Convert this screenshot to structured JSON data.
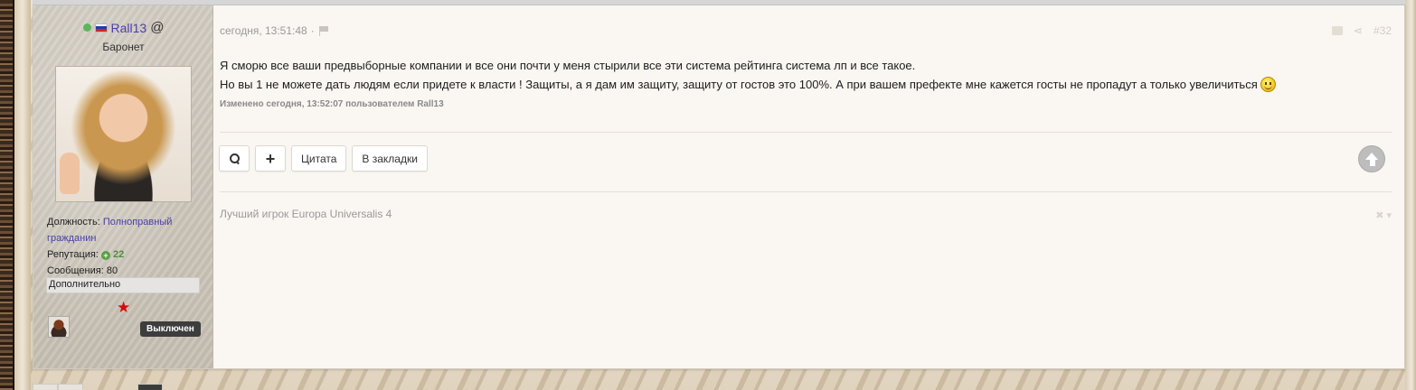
{
  "user": {
    "name": "Rall13",
    "at_symbol": "@",
    "title": "Баронет",
    "position_label": "Должность:",
    "position_value": "Полноправный гражданин",
    "reputation_label": "Репутация:",
    "reputation_value": "22",
    "messages_label": "Сообщения:",
    "messages_value": "80",
    "more_label": "Дополнительно",
    "status_badge": "Выключен",
    "online_color": "#5db55d"
  },
  "post": {
    "timestamp": "сегодня, 13:51:48",
    "separator": "·",
    "number": "#32",
    "line1": "Я сморю все ваши предвыборные компании и все они почти у меня стырили все эти система рейтинга система лп и все такое.",
    "line2": "Но вы 1 не можете дать людям если придете к власти ! Защиты, а я дам им защиту, защиту от гостов это 100%. А при вашем префекте мне кажется госты не пропадут а только увеличиться",
    "edited": "Изменено сегодня, 13:52:07 пользователем Rall13",
    "signature": "Лучший игрок Europa Universalis 4"
  },
  "actions": {
    "search_icon": "search-icon",
    "plus_label": "+",
    "quote_label": "Цитата",
    "bookmark_label": "В закладки"
  },
  "icons": {
    "share": "⋖",
    "close": "✖ ▾"
  }
}
